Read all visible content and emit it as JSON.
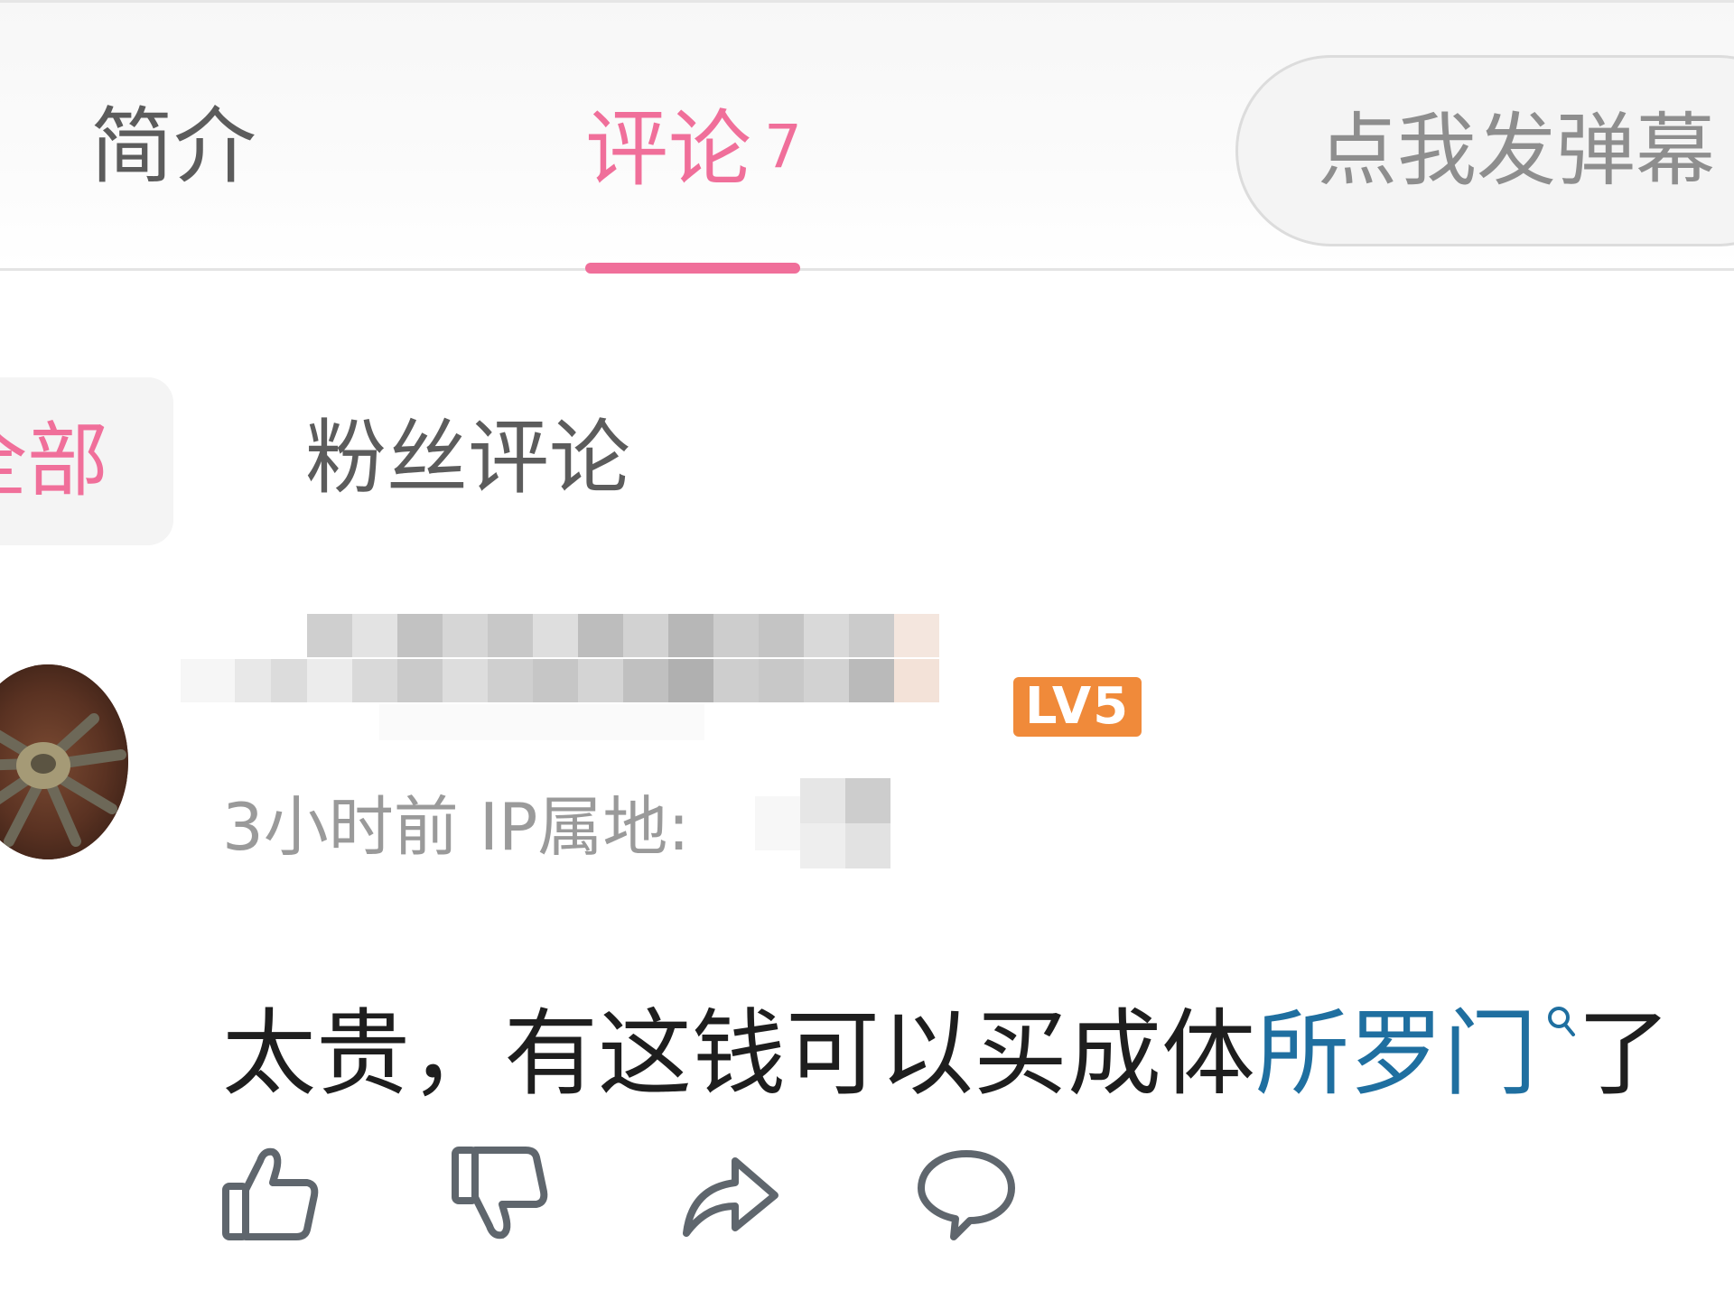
{
  "tabs": {
    "intro_label": "简介",
    "comments_label": "评论",
    "comments_count": "7",
    "danmaku_placeholder": "点我发弹幕"
  },
  "filters": {
    "all_label": "全部",
    "fans_label": "粉丝评论"
  },
  "comment": {
    "level_badge": "LV5",
    "time": "3小时前",
    "ip_label": "IP属地:",
    "text_before": "太贵，有这钱可以买成体",
    "keyword": "所罗门",
    "text_after": "了"
  },
  "icons": {
    "like": "thumbs-up-icon",
    "dislike": "thumbs-down-icon",
    "share": "share-icon",
    "reply": "comment-bubble-icon",
    "search": "search-icon"
  },
  "colors": {
    "accent_pink": "#f06f9a",
    "keyword_blue": "#1f6fa0",
    "level_orange": "#f08a3a",
    "muted_text": "#9a9a9a"
  }
}
